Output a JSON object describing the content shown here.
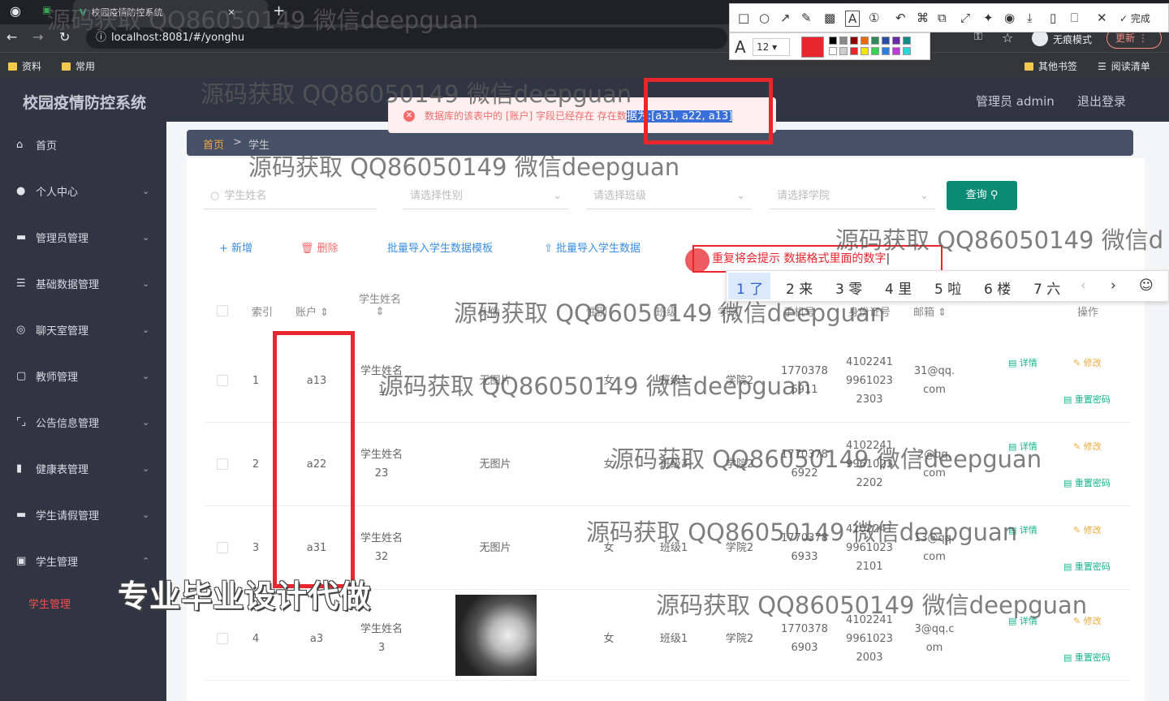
{
  "browser": {
    "tab_title": "校园疫情防控系统",
    "url": "localhost:8081/#/yonghu",
    "bookmarks": [
      "资料",
      "常用"
    ],
    "other_bookmarks": "其他书签",
    "reading_list": "阅读清单",
    "incognito_label": "无痕模式",
    "update_label": "更新"
  },
  "app": {
    "title": "校园疫情防控系统",
    "admin_label": "管理员 admin",
    "logout_label": "退出登录"
  },
  "sidebar": {
    "items": [
      {
        "label": "首页",
        "icon": "home-icon"
      },
      {
        "label": "个人中心",
        "icon": "user-icon"
      },
      {
        "label": "管理员管理",
        "icon": "monitor-icon"
      },
      {
        "label": "基础数据管理",
        "icon": "list-icon"
      },
      {
        "label": "聊天室管理",
        "icon": "chat-icon"
      },
      {
        "label": "教师管理",
        "icon": "copy-icon"
      },
      {
        "label": "公告信息管理",
        "icon": "bracket-icon"
      },
      {
        "label": "健康表管理",
        "icon": "bar-icon"
      },
      {
        "label": "学生请假管理",
        "icon": "badge-icon"
      },
      {
        "label": "学生管理",
        "icon": "id-card-icon"
      }
    ],
    "active_sub": "学生管理"
  },
  "breadcrumb": {
    "home": "首页",
    "sep": ">",
    "current": "学生"
  },
  "search": {
    "name_placeholder": "学生姓名",
    "gender_placeholder": "请选择性别",
    "class_placeholder": "请选择班级",
    "college_placeholder": "请选择学院",
    "query_label": "查询"
  },
  "actions": {
    "add": "+ 新增",
    "delete": "删除",
    "template": "批量导入学生数据模板",
    "import": "批量导入学生数据"
  },
  "table": {
    "headers": [
      "索引",
      "账户",
      "学生姓名",
      "头像",
      "性别",
      "班级",
      "学院",
      "手机号",
      "身份证号",
      "邮箱",
      "操作"
    ],
    "rows": [
      {
        "idx": "1",
        "account": "a13",
        "name": "学生姓名\n1̲",
        "avatar": "无图片",
        "gender": "女",
        "class": "班级1",
        "college": "学院2",
        "phone": "1770378\n6911",
        "idcard": "4102241\n9961023\n2303",
        "email": "31@qq.\ncom"
      },
      {
        "idx": "2",
        "account": "a22",
        "name": "学生姓名\n23",
        "avatar": "无图片",
        "gender": "女",
        "class": "班级3",
        "college": "学院2",
        "phone": "1770378\n6922",
        "idcard": "4102241\n9961023\n2202",
        "email": "2@qq.\ncom"
      },
      {
        "idx": "3",
        "account": "a31",
        "name": "学生姓名\n32",
        "avatar": "无图片",
        "gender": "女",
        "class": "班级1",
        "college": "学院2",
        "phone": "1770378\n6933",
        "idcard": "4102241\n9961023\n2101",
        "email": "13@qq.\ncom"
      },
      {
        "idx": "4",
        "account": "a3",
        "name": "学生姓名\n3",
        "avatar": "",
        "gender": "女",
        "class": "班级1",
        "college": "学院2",
        "phone": "1770378\n6903",
        "idcard": "4102241\n9961023\n2003",
        "email": "3@qq.c\nom"
      }
    ],
    "op_detail": "详情",
    "op_edit": "修改",
    "op_reset": "重置密码"
  },
  "error_msg": {
    "prefix": "数据库的该表中的 [账户] 字段已经存在 存在数",
    "highlight": "据为:[a31, a22, a13]"
  },
  "annotation": {
    "text": "重复将会提示 数据格式里面的数字"
  },
  "ime": {
    "candidates": [
      "1 了",
      "2 来",
      "3 零",
      "4 里",
      "5 啦",
      "6 楼",
      "7 六"
    ]
  },
  "annot_toolbar": {
    "font_size": "12",
    "done": "完成",
    "font_label": "A"
  },
  "watermark": {
    "text": "源码获取 QQ86050149 微信deepguan",
    "text_cut": "源码获取 QQ86050149 微信d",
    "stamp": "专业毕业设计代做"
  }
}
